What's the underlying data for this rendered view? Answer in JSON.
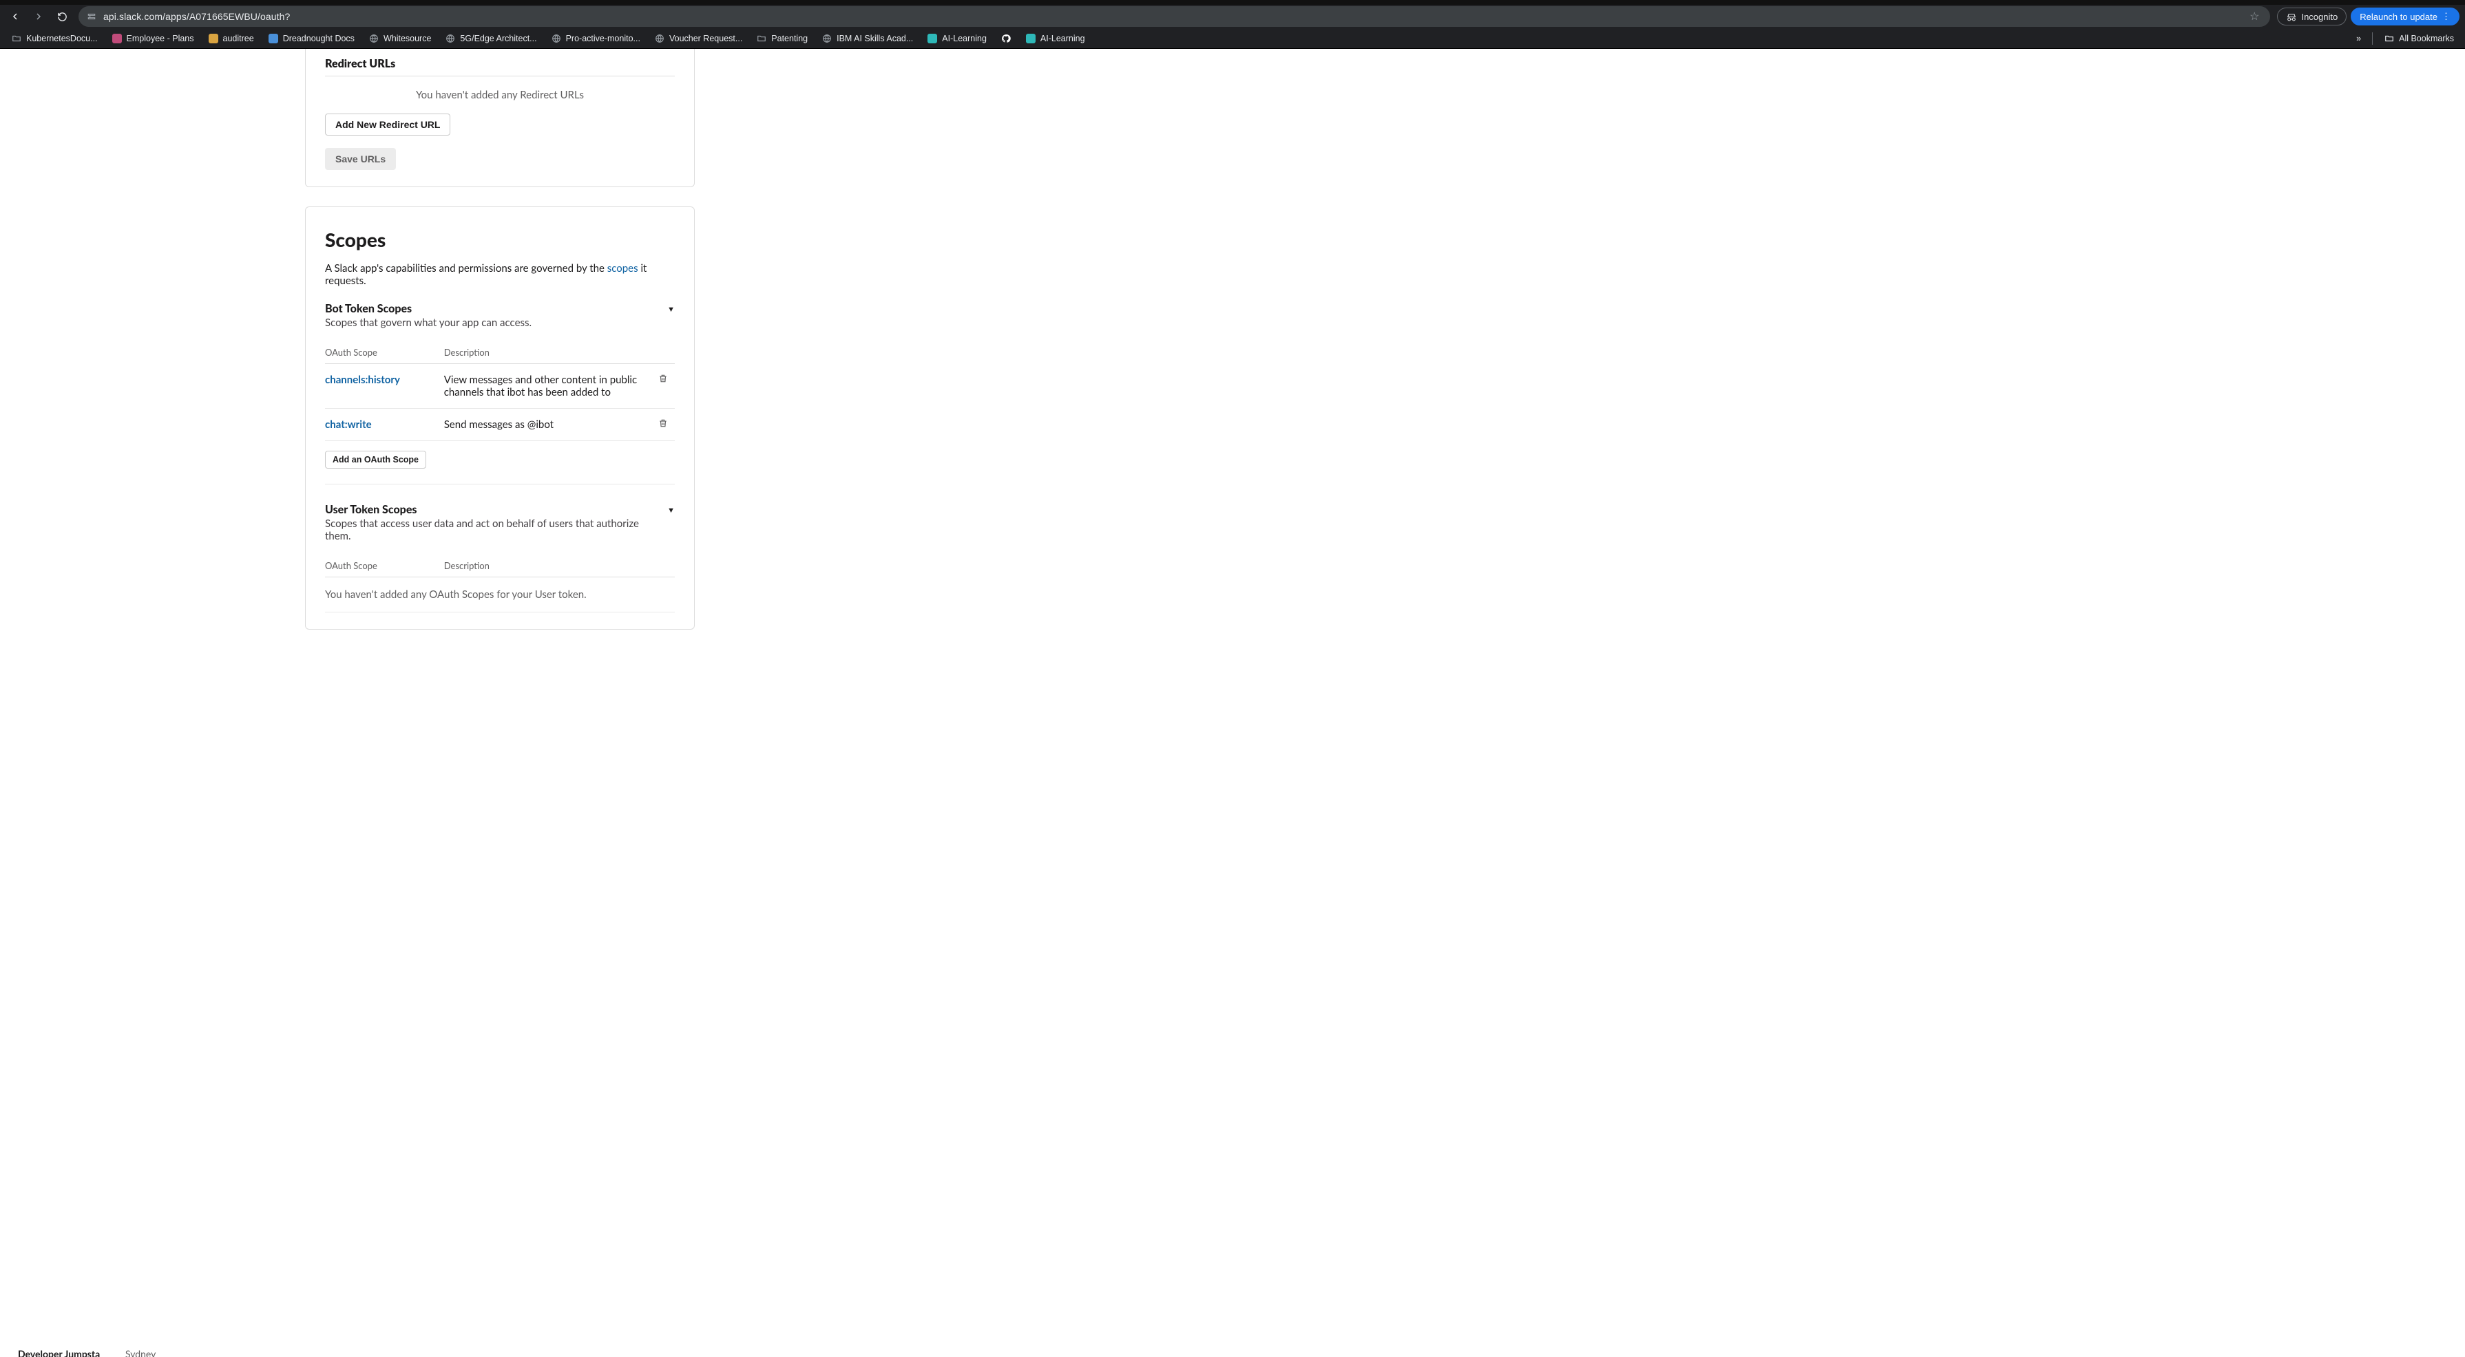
{
  "browser": {
    "url": "api.slack.com/apps/A071665EWBU/oauth?",
    "incognito_label": "Incognito",
    "relaunch_label": "Relaunch to update",
    "all_bookmarks_label": "All Bookmarks",
    "bookmarks": [
      {
        "label": "KubernetesDocu...",
        "color": "#9aa0a6",
        "glyph": ""
      },
      {
        "label": "Employee - Plans",
        "color": "#c04b7a",
        "glyph": ""
      },
      {
        "label": "auditree",
        "color": "#d9a441",
        "glyph": ""
      },
      {
        "label": "Dreadnought Docs",
        "color": "#4a90d9",
        "glyph": ""
      },
      {
        "label": "Whitesource",
        "color": "#9aa0a6",
        "glyph": ""
      },
      {
        "label": "5G/Edge Architect...",
        "color": "#9aa0a6",
        "glyph": ""
      },
      {
        "label": "Pro-active-monito...",
        "color": "#9aa0a6",
        "glyph": ""
      },
      {
        "label": "Voucher Request...",
        "color": "#9aa0a6",
        "glyph": ""
      },
      {
        "label": "Patenting",
        "color": "#9aa0a6",
        "glyph": ""
      },
      {
        "label": "IBM AI Skills Acad...",
        "color": "#9aa0a6",
        "glyph": ""
      },
      {
        "label": "AI-Learning",
        "color": "#2eb8b8",
        "glyph": ""
      },
      {
        "label": "",
        "color": "#ffffff",
        "glyph": "gh"
      },
      {
        "label": "AI-Learning",
        "color": "#2eb8b8",
        "glyph": ""
      }
    ]
  },
  "redirect": {
    "title": "Redirect URLs",
    "empty": "You haven't added any Redirect URLs",
    "add_btn": "Add New Redirect URL",
    "save_btn": "Save URLs"
  },
  "scopes": {
    "heading": "Scopes",
    "intro_prefix": "A Slack app's capabilities and permissions are governed by the ",
    "intro_link": "scopes",
    "intro_suffix": " it requests.",
    "col_scope": "OAuth Scope",
    "col_desc": "Description",
    "add_btn": "Add an OAuth Scope",
    "bot": {
      "title": "Bot Token Scopes",
      "subtitle": "Scopes that govern what your app can access.",
      "rows": [
        {
          "scope": "channels:history",
          "desc": "View messages and other content in public channels that ibot has been added to"
        },
        {
          "scope": "chat:write",
          "desc": "Send messages as @ibot"
        }
      ]
    },
    "user": {
      "title": "User Token Scopes",
      "subtitle": "Scopes that access user data and act on behalf of users that authorize them.",
      "empty": "You haven't added any OAuth Scopes for your User token."
    }
  },
  "left_nav_peek": {
    "item": "Developer Jumpsta",
    "region": "Sydney"
  }
}
